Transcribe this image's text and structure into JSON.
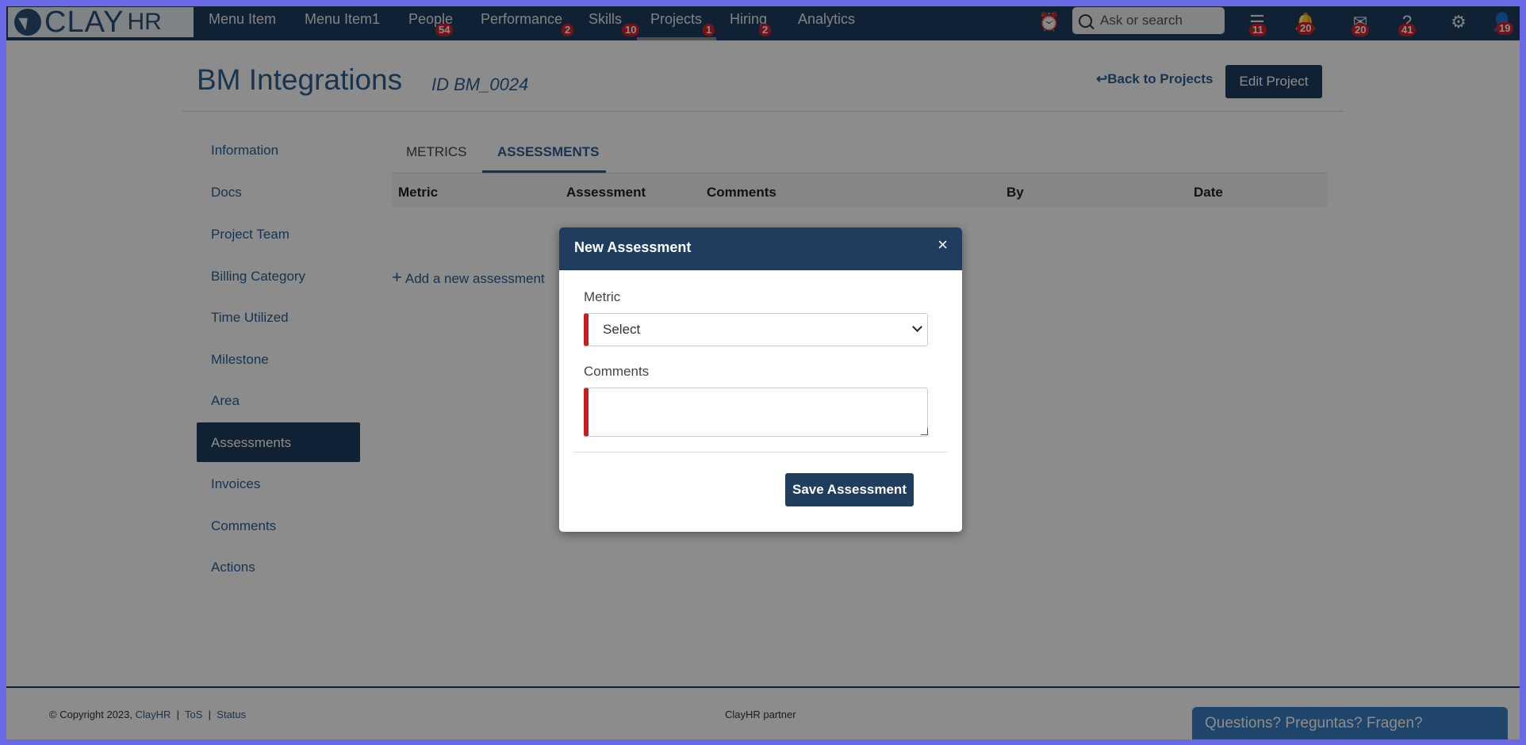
{
  "logo": {
    "text": "CLAY",
    "suffix": "HR"
  },
  "nav": {
    "items": [
      {
        "label": "Menu Item",
        "badge": ""
      },
      {
        "label": "Menu Item1",
        "badge": ""
      },
      {
        "label": "People",
        "badge": "54"
      },
      {
        "label": "Performance",
        "badge": "2"
      },
      {
        "label": "Skills",
        "badge": "10"
      },
      {
        "label": "Projects",
        "badge": "1"
      },
      {
        "label": "Hiring",
        "badge": "2"
      },
      {
        "label": "Analytics",
        "badge": ""
      }
    ],
    "search_placeholder": "Ask or search",
    "icons": [
      {
        "name": "alarm-clock-icon",
        "badge": ""
      },
      {
        "name": "stack-icon",
        "badge": "11"
      },
      {
        "name": "bell-icon",
        "badge": "20"
      },
      {
        "name": "mail-icon",
        "badge": "20"
      },
      {
        "name": "help-icon",
        "badge": "41"
      },
      {
        "name": "gear-icon",
        "badge": ""
      },
      {
        "name": "user-icon",
        "badge": "19"
      }
    ]
  },
  "header": {
    "title": "BM Integrations",
    "id": "ID BM_0024",
    "back_link": "Back to Projects",
    "edit_button": "Edit Project"
  },
  "sidebar": {
    "items": [
      "Information",
      "Docs",
      "Project Team",
      "Billing Category",
      "Time Utilized",
      "Milestone",
      "Area",
      "Assessments",
      "Invoices",
      "Comments",
      "Actions"
    ],
    "active": "Assessments"
  },
  "tabs": [
    "METRICS",
    "ASSESSMENTS"
  ],
  "table": {
    "columns": [
      "Metric",
      "Assessment",
      "Comments",
      "By",
      "Date"
    ]
  },
  "add_link": "Add a new assessment",
  "modal": {
    "title": "New Assessment",
    "metric_label": "Metric",
    "metric_value": "Select",
    "comments_label": "Comments",
    "comments_value": "",
    "save_button": "Save Assessment"
  },
  "footer": {
    "copyright": "© Copyright 2023,",
    "company_link": "ClayHR",
    "tos": "ToS",
    "status": "Status",
    "partner": "ClayHR partner",
    "help": "Questions? Preguntas? Fragen?"
  },
  "colors": {
    "nav": "#1f3d5f",
    "accent": "#2f5f91",
    "badge": "#d0242b",
    "required": "#c81e1e"
  }
}
